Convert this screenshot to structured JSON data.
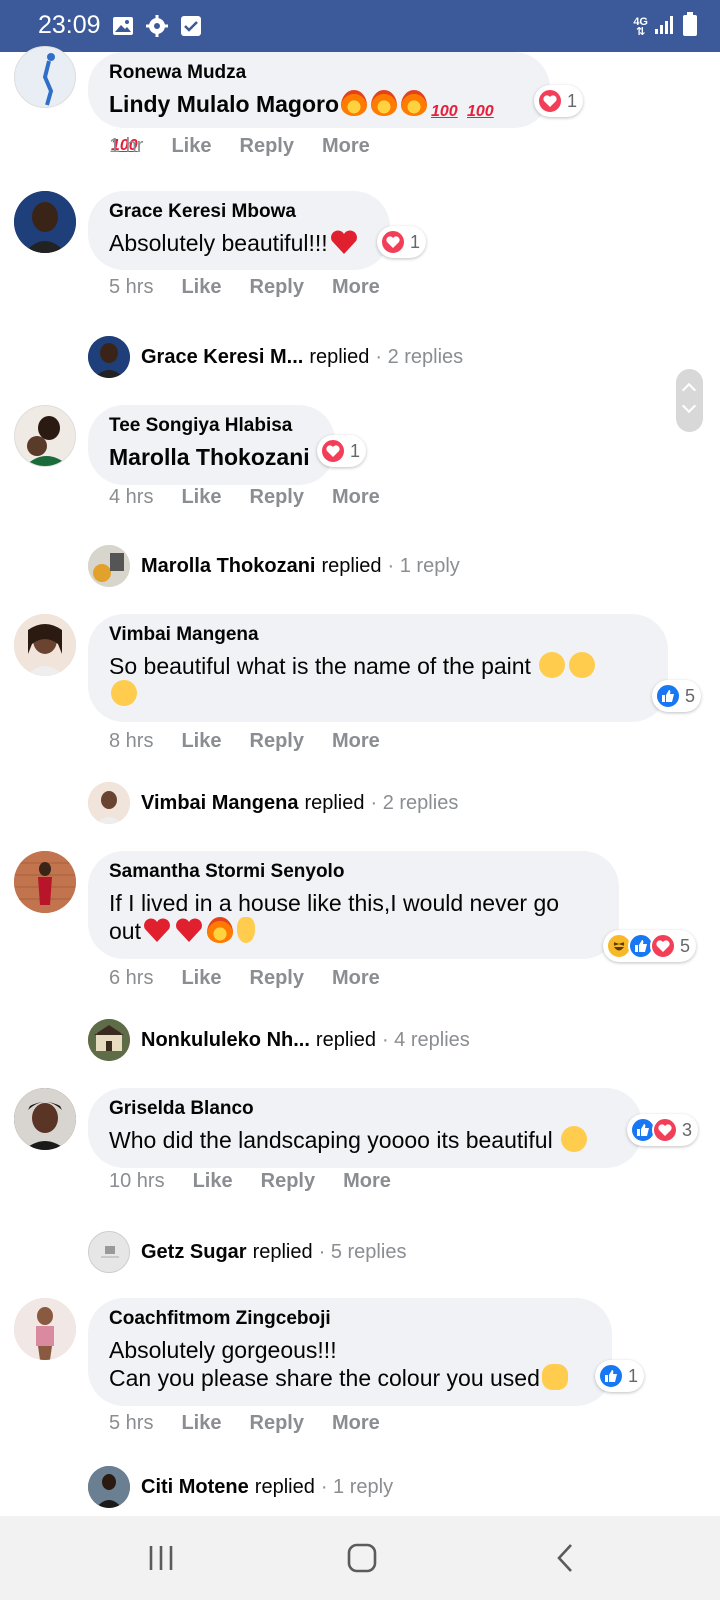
{
  "status_bar": {
    "time": "23:09",
    "network": "4G",
    "icons": [
      "image-icon",
      "gear-icon",
      "checkbox-icon",
      "signal-icon",
      "battery-icon"
    ]
  },
  "comments": [
    {
      "author": "Ronewa Mudza",
      "text": "Lindy Mulalo Magoro",
      "emojis": [
        "fire",
        "fire",
        "fire",
        "100",
        "100",
        "100"
      ],
      "reactions": [
        "love"
      ],
      "reaction_count": "1",
      "time": "1 hr",
      "actions": [
        "Like",
        "Reply",
        "More"
      ]
    },
    {
      "author": "Grace Keresi Mbowa",
      "text": "Absolutely beautiful!!!",
      "emojis": [
        "heart"
      ],
      "reactions": [
        "love"
      ],
      "reaction_count": "1",
      "time": "5 hrs",
      "actions": [
        "Like",
        "Reply",
        "More"
      ],
      "reply_summary": {
        "name": "Grace Keresi M...",
        "word": "replied",
        "count": "· 2 replies"
      }
    },
    {
      "author": "Tee Songiya Hlabisa",
      "text": "Marolla Thokozani",
      "reactions": [
        "love"
      ],
      "reaction_count": "1",
      "time": "4 hrs",
      "actions": [
        "Like",
        "Reply",
        "More"
      ],
      "reply_summary": {
        "name": "Marolla Thokozani",
        "word": "replied",
        "count": "· 1 reply"
      }
    },
    {
      "author": "Vimbai Mangena",
      "text_line1": "So beautiful what is the name of the paint",
      "emojis": [
        "kiss",
        "kiss",
        "kiss"
      ],
      "reactions": [
        "like"
      ],
      "reaction_count": "5",
      "time": "8 hrs",
      "actions": [
        "Like",
        "Reply",
        "More"
      ],
      "reply_summary": {
        "name": "Vimbai Mangena",
        "word": "replied",
        "count": "· 2 replies"
      }
    },
    {
      "author": "Samantha Stormi Senyolo",
      "text_line1": "If I lived in a house like this,I would never go",
      "text_line2": "out",
      "emojis": [
        "heart",
        "heart",
        "fire",
        "finger"
      ],
      "reactions": [
        "haha",
        "like",
        "love"
      ],
      "reaction_count": "5",
      "time": "6 hrs",
      "actions": [
        "Like",
        "Reply",
        "More"
      ],
      "reply_summary": {
        "name": "Nonkululeko Nh...",
        "word": "replied",
        "count": "· 4 replies"
      }
    },
    {
      "author": "Griselda Blanco",
      "text": "Who did the landscaping yoooo its beautiful",
      "emojis": [
        "heart-eyes"
      ],
      "reactions": [
        "like",
        "love"
      ],
      "reaction_count": "3",
      "time": "10 hrs",
      "actions": [
        "Like",
        "Reply",
        "More"
      ],
      "reply_summary": {
        "name": "Getz Sugar",
        "word": "replied",
        "count": "· 5 replies"
      }
    },
    {
      "author": "Coachfitmom Zingceboji",
      "text_line1": "Absolutely gorgeous!!!",
      "text_line2": "Can you please share the colour you used",
      "emojis": [
        "clap"
      ],
      "reactions": [
        "like"
      ],
      "reaction_count": "1",
      "time": "5 hrs",
      "actions": [
        "Like",
        "Reply",
        "More"
      ],
      "reply_summary": {
        "name": "Citi Motene",
        "word": "replied",
        "count": "· 1 reply"
      }
    }
  ],
  "colors": {
    "status_bar": "#3c5a99",
    "bubble": "#f0f2f5",
    "meta_text": "#8a8d91",
    "like_blue": "#1877f2",
    "love_red": "#f33e58"
  }
}
